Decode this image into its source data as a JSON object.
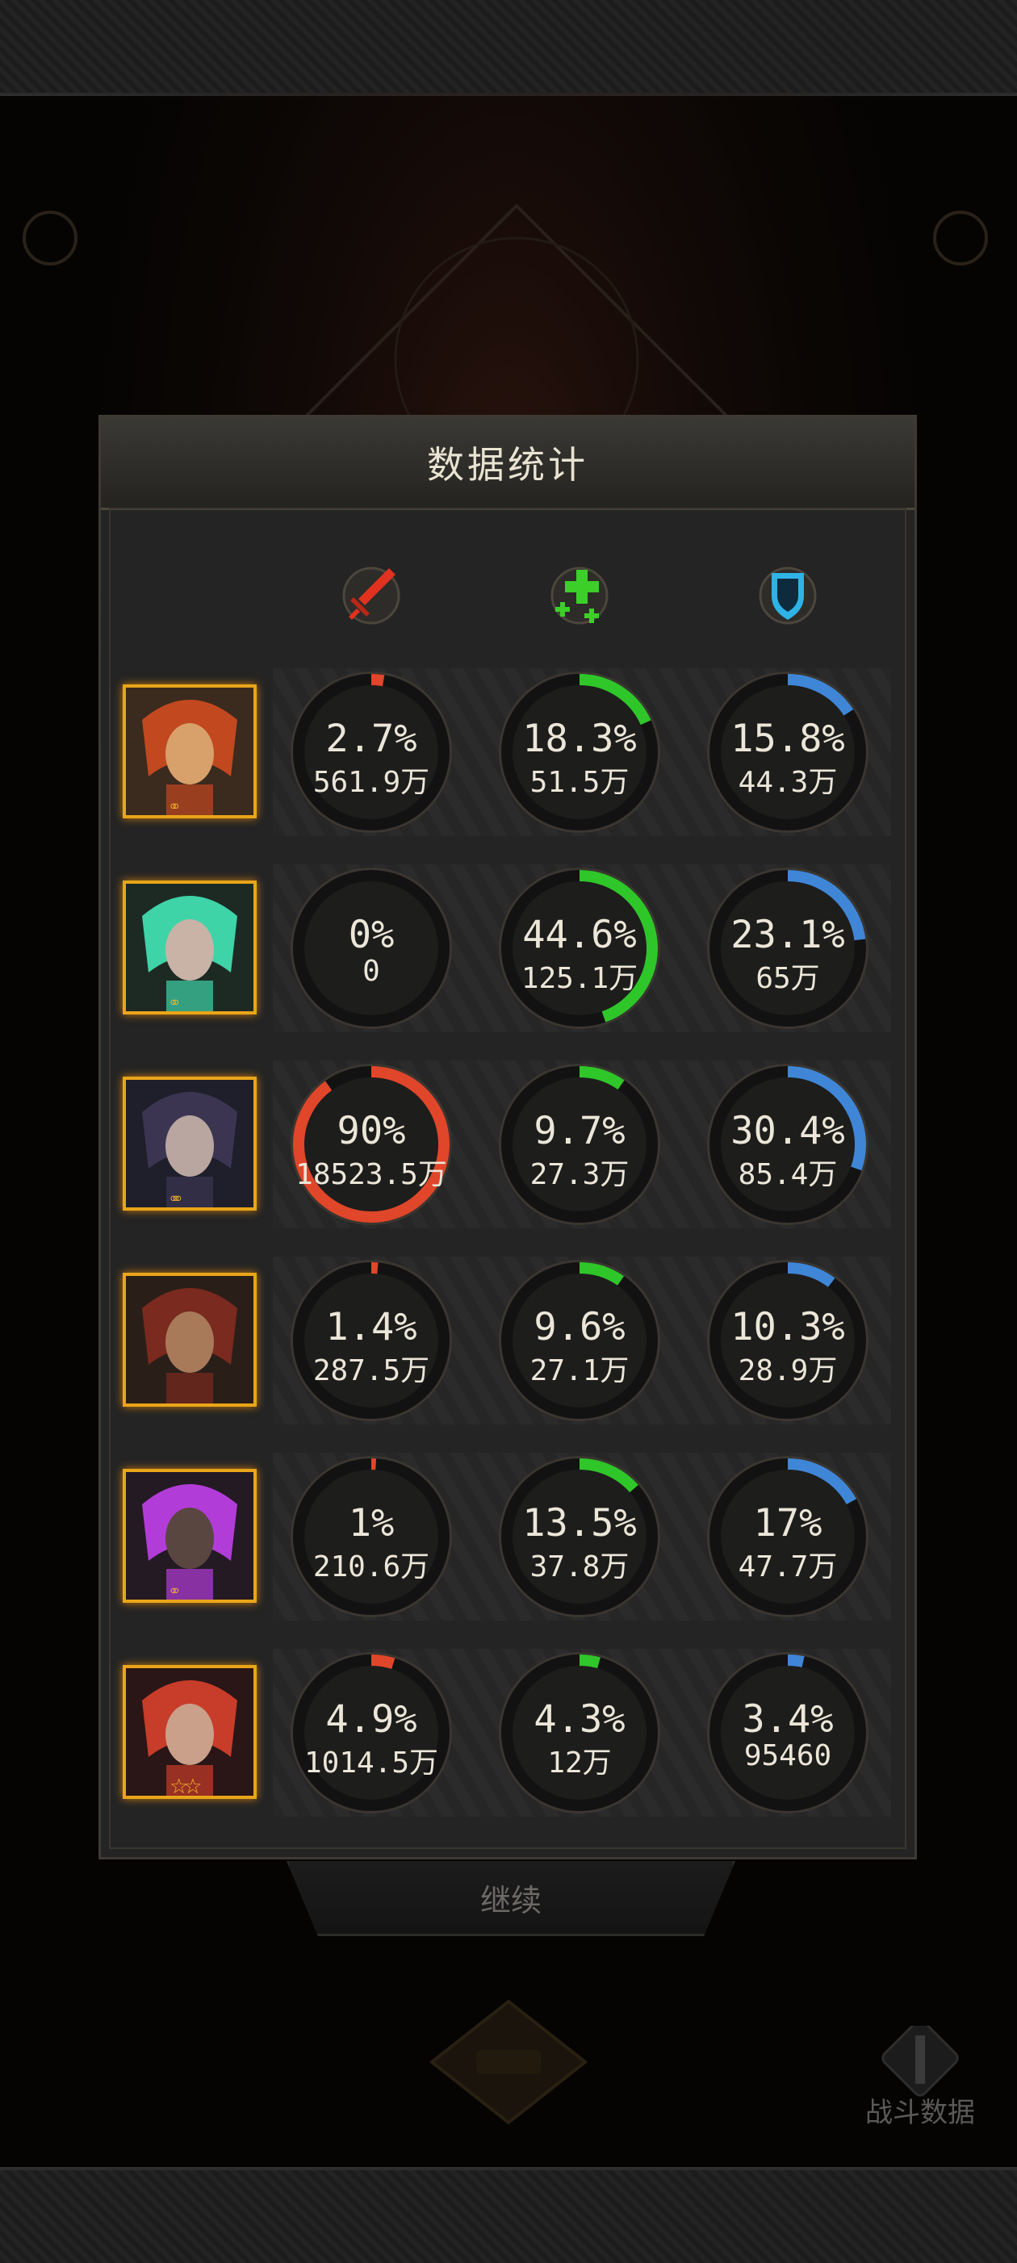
{
  "title": "数据统计",
  "continue_label": "继续",
  "battle_data_label": "战斗数据",
  "columns": [
    {
      "icon": "sword-icon",
      "color": "#e0321f"
    },
    {
      "icon": "heal-cross-icon",
      "color": "#3ccf2a"
    },
    {
      "icon": "shield-icon",
      "color": "#2fb3e6"
    }
  ],
  "colors": {
    "damage": "#e0462a",
    "heal": "#2fc62a",
    "shield": "#3f86d6",
    "frame": "#e9a519"
  },
  "rows": [
    {
      "hero": "hero-red-hair-elf",
      "stars": "◦◦",
      "damage": {
        "pct": "2.7%",
        "val": "561.9万",
        "ratio": 0.027
      },
      "heal": {
        "pct": "18.3%",
        "val": "51.5万",
        "ratio": 0.183
      },
      "shield": {
        "pct": "15.8%",
        "val": "44.3万",
        "ratio": 0.158
      }
    },
    {
      "hero": "hero-antler-druid",
      "stars": "◦◦",
      "damage": {
        "pct": "0%",
        "val": "0",
        "ratio": 0
      },
      "heal": {
        "pct": "44.6%",
        "val": "125.1万",
        "ratio": 0.446
      },
      "shield": {
        "pct": "23.1%",
        "val": "65万",
        "ratio": 0.231
      }
    },
    {
      "hero": "hero-dark-sorceress",
      "stars": "◦◦◦",
      "damage": {
        "pct": "90%",
        "val": "18523.5万",
        "ratio": 0.9
      },
      "heal": {
        "pct": "9.7%",
        "val": "27.3万",
        "ratio": 0.097
      },
      "shield": {
        "pct": "30.4%",
        "val": "85.4万",
        "ratio": 0.304
      }
    },
    {
      "hero": "hero-bandana-pirate",
      "stars": "",
      "damage": {
        "pct": "1.4%",
        "val": "287.5万",
        "ratio": 0.014
      },
      "heal": {
        "pct": "9.6%",
        "val": "27.1万",
        "ratio": 0.096
      },
      "shield": {
        "pct": "10.3%",
        "val": "28.9万",
        "ratio": 0.103
      }
    },
    {
      "hero": "hero-purple-eyed-warrior",
      "stars": "◦◦",
      "damage": {
        "pct": "1%",
        "val": "210.6万",
        "ratio": 0.01
      },
      "heal": {
        "pct": "13.5%",
        "val": "37.8万",
        "ratio": 0.135
      },
      "shield": {
        "pct": "17%",
        "val": "47.7万",
        "ratio": 0.17
      }
    },
    {
      "hero": "hero-red-hair-rogue",
      "stars": "☆☆",
      "damage": {
        "pct": "4.9%",
        "val": "1014.5万",
        "ratio": 0.049
      },
      "heal": {
        "pct": "4.3%",
        "val": "12万",
        "ratio": 0.043
      },
      "shield": {
        "pct": "3.4%",
        "val": "95460",
        "ratio": 0.034
      }
    }
  ]
}
